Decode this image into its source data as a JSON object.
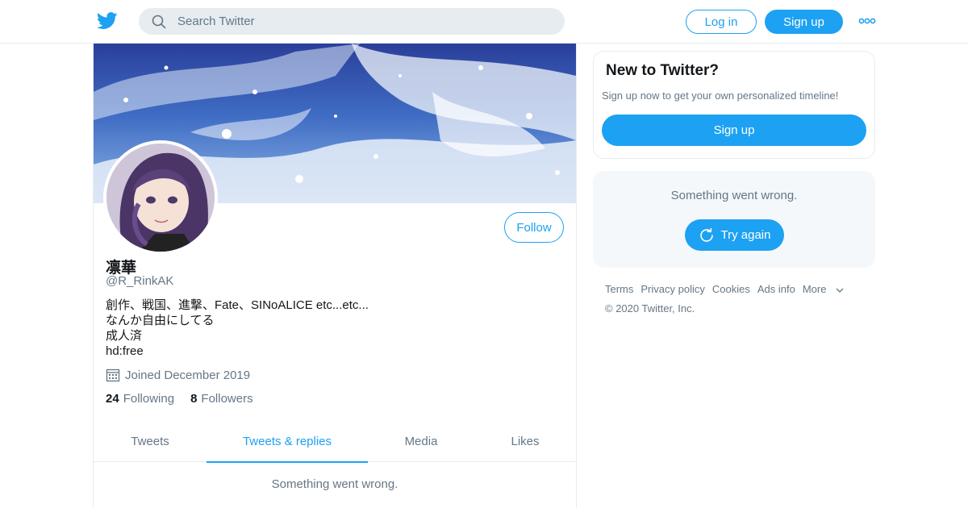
{
  "header": {
    "search_placeholder": "Search Twitter",
    "login_label": "Log in",
    "signup_label": "Sign up",
    "brand_color": "#1da1f2"
  },
  "profile": {
    "display_name": "凛華",
    "handle": "@R_RinkAK",
    "bio_lines": [
      "創作、戦国、進撃、Fate、SINoALICE etc...etc...",
      "なんか自由にしてる",
      "成人済",
      "hd:free"
    ],
    "joined": "Joined December 2019",
    "following_count": "24",
    "following_label": "Following",
    "followers_count": "8",
    "followers_label": "Followers",
    "follow_label": "Follow"
  },
  "tabs": [
    {
      "label": "Tweets",
      "active": false
    },
    {
      "label": "Tweets & replies",
      "active": true
    },
    {
      "label": "Media",
      "active": false
    },
    {
      "label": "Likes",
      "active": false
    }
  ],
  "feed": {
    "error_text": "Something went wrong."
  },
  "sidebar": {
    "new_title": "New to Twitter?",
    "new_subtitle": "Sign up now to get your own personalized timeline!",
    "signup_label": "Sign up",
    "error_text": "Something went wrong.",
    "retry_label": "Try again",
    "footer_links": [
      "Terms",
      "Privacy policy",
      "Cookies",
      "Ads info",
      "More"
    ],
    "copyright": "© 2020 Twitter, Inc."
  },
  "icons": {
    "logo": "twitter-bird-icon",
    "search": "search-icon",
    "more": "more-dots-icon",
    "calendar": "calendar-icon",
    "retry": "refresh-icon",
    "chevron": "chevron-down-icon"
  }
}
